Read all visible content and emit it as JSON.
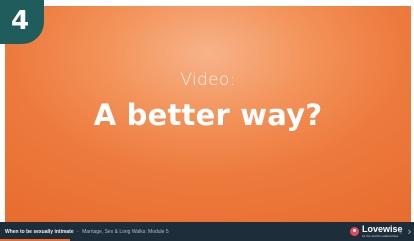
{
  "slide": {
    "number": "4",
    "subtitle": "Video:",
    "title": "A better way?"
  },
  "player_bar": {
    "caption_title": "When to be sexually intimate",
    "caption_separator": "·",
    "caption_course": "Marriage, Sex & Long Walks: Module 5",
    "brand_name": "Lovewise",
    "brand_tagline": "for the world's relationships",
    "prev_icon": "chevron-left-icon",
    "next_icon": "chevron-right-icon"
  },
  "colors": {
    "slide_orange": "#ed7a3d",
    "badge_teal": "#1f5c5c",
    "bar_navy": "#1e2d3a",
    "brand_red": "#e8475b"
  }
}
